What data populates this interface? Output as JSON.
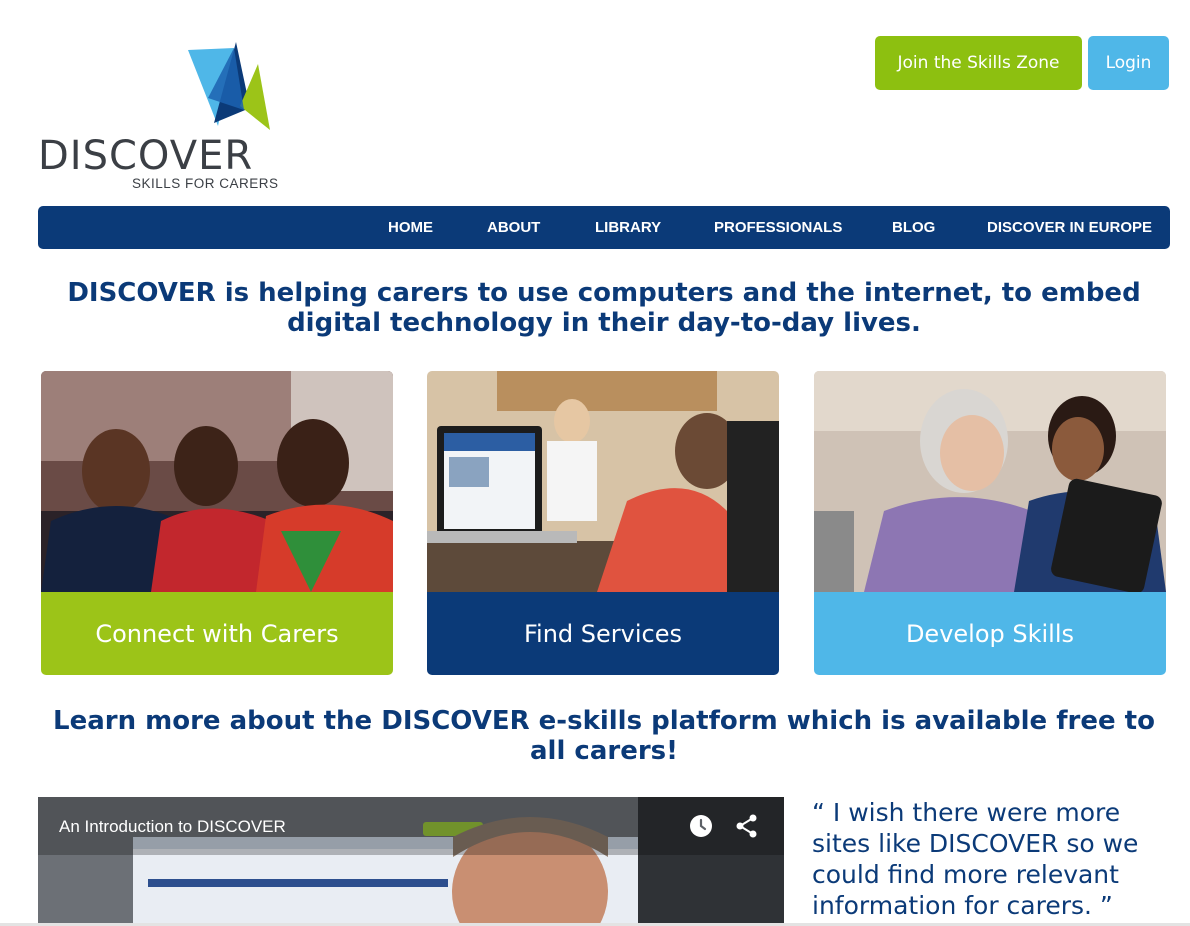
{
  "logo": {
    "word": "DISCOVER",
    "tagline": "SKILLS FOR CARERS"
  },
  "header": {
    "join_label": "Join the Skills Zone",
    "login_label": "Login"
  },
  "nav": {
    "items": [
      "HOME",
      "ABOUT",
      "LIBRARY",
      "PROFESSIONALS",
      "BLOG",
      "DISCOVER IN EUROPE"
    ]
  },
  "headline": "DISCOVER is helping carers to use computers and the internet, to embed digital technology in their day-to-day lives.",
  "cards": [
    {
      "label": "Connect with Carers",
      "color": "#9cc418"
    },
    {
      "label": "Find Services",
      "color": "#0b3a78"
    },
    {
      "label": "Develop Skills",
      "color": "#4fb7e8"
    }
  ],
  "learn_more": "Learn more about the DISCOVER e-skills platform which is available free to all carers!",
  "video": {
    "title": "An Introduction to DISCOVER",
    "icons": [
      "clock-icon",
      "share-icon"
    ]
  },
  "quote": "“ I wish there were more sites like DISCOVER so we could find more relevant information for carers. ”",
  "colors": {
    "navy": "#0b3a78",
    "green": "#8dc010",
    "sky": "#4fb7e8"
  }
}
